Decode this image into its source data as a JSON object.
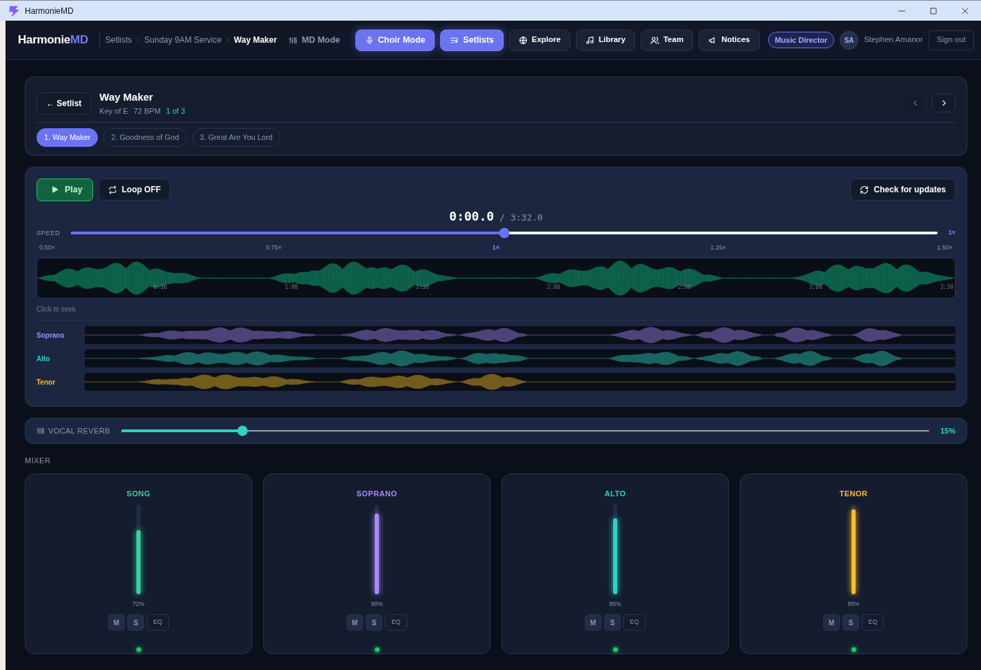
{
  "window": {
    "title": "HarmonieMD"
  },
  "nav": {
    "brand": "Harmonie",
    "brand_accent": "MD",
    "breadcrumb": [
      "Setlists",
      "Sunday 9AM Service",
      "Way Maker"
    ],
    "modes": [
      {
        "label": "MD Mode",
        "selected": false
      },
      {
        "label": "Choir Mode",
        "selected": true
      },
      {
        "label": "Setlists",
        "selected": true
      },
      {
        "label": "Explore",
        "selected": false
      },
      {
        "label": "Library",
        "selected": false
      },
      {
        "label": "Team",
        "selected": false
      },
      {
        "label": "Notices",
        "selected": false
      }
    ],
    "role": "Music Director",
    "avatar": "SA",
    "user": "Stephen Amanor",
    "sign_out": "Sign out"
  },
  "song": {
    "back": "← Setlist",
    "title": "Way Maker",
    "key": "Key of E",
    "bpm": "72 BPM",
    "position": "1 of 3",
    "prev_disabled": true,
    "next_disabled": false,
    "tabs": [
      {
        "label": "1. Way Maker",
        "selected": true
      },
      {
        "label": "2. Goodness of God",
        "selected": false
      },
      {
        "label": "3. Great Are You Lord",
        "selected": false
      }
    ]
  },
  "player": {
    "play": "Play",
    "loop": "Loop OFF",
    "update": "Check for updates",
    "time": "0:00.0",
    "separator": "/",
    "duration": "3:32.0",
    "speed": {
      "label": "SPEED",
      "level": 0.5,
      "reading": "1×",
      "ticks": [
        {
          "label": "0.50×",
          "selected": false
        },
        {
          "label": "0.75×",
          "selected": false
        },
        {
          "label": "1×",
          "selected": true
        },
        {
          "label": "1.25×",
          "selected": false
        },
        {
          "label": "1.50×",
          "selected": false
        }
      ]
    },
    "timeline": [
      "0:30",
      "1:00",
      "1:30",
      "2:00",
      "2:30",
      "3:00",
      "3:30"
    ],
    "hint": "Click to seek",
    "tracks": [
      {
        "name": "Soprano",
        "color": "#a78bfa"
      },
      {
        "name": "Alto",
        "color": "#2dd4bf"
      },
      {
        "name": "Tenor",
        "color": "#fbbf24"
      }
    ]
  },
  "reverb": {
    "label": "VOCAL REVERB",
    "level": 0.15,
    "reading": "15%"
  },
  "mixer": {
    "title": "MIXER",
    "channels": [
      {
        "name": "SONG",
        "color": "#34d399",
        "level": 0.72,
        "reading": "72%",
        "buttons": [
          "M",
          "S",
          "EQ"
        ],
        "active": true
      },
      {
        "name": "SOPRANO",
        "color": "#a78bfa",
        "level": 0.9,
        "reading": "90%",
        "buttons": [
          "M",
          "S",
          "EQ"
        ],
        "active": true
      },
      {
        "name": "ALTO",
        "color": "#2dd4bf",
        "level": 0.85,
        "reading": "85%",
        "buttons": [
          "M",
          "S",
          "EQ"
        ],
        "active": true
      },
      {
        "name": "TENOR",
        "color": "#fbbf24",
        "level": 0.95,
        "reading": "95%",
        "buttons": [
          "M",
          "S",
          "EQ"
        ],
        "active": true
      }
    ]
  }
}
